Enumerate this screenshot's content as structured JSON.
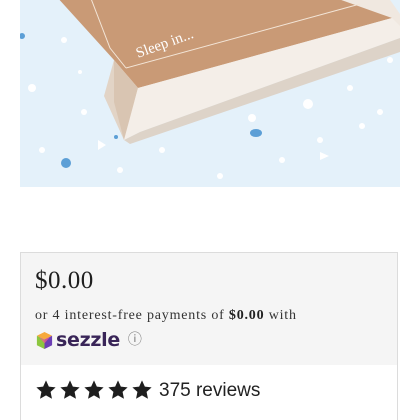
{
  "image": {
    "box_text": "Sleep in..."
  },
  "pricing": {
    "price": "$0.00",
    "installments_prefix": "or 4 interest-free payments of ",
    "installment_amount": "$0.00",
    "installments_suffix": " with",
    "provider": "sezzle",
    "info_icon": "info-icon"
  },
  "reviews": {
    "rating": 5,
    "max_rating": 5,
    "label": "375 reviews"
  },
  "colors": {
    "background_image": "#e4f1fa",
    "confetti": "#5c9fd6",
    "box": "#c99a76",
    "card_bg": "#f5f5f5",
    "sezzle_brand": "#392558"
  }
}
